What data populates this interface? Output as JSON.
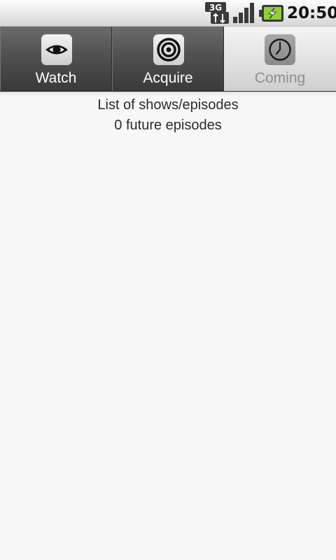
{
  "status_bar": {
    "network_type": "3G",
    "network_icon": "3g-data-icon",
    "signal_icon": "signal-strength-icon",
    "battery_icon": "battery-charging-icon",
    "time": "20:50"
  },
  "tabs": [
    {
      "label": "Watch",
      "icon": "eye-icon",
      "selected": false
    },
    {
      "label": "Acquire",
      "icon": "target-icon",
      "selected": false
    },
    {
      "label": "Coming",
      "icon": "clock-icon",
      "selected": true
    }
  ],
  "content": {
    "heading": "List of shows/episodes",
    "summary": "0 future episodes"
  },
  "colors": {
    "background": "#f7f7f7",
    "tab_inactive": "#505050",
    "tab_active": "#e3e3e3",
    "battery_green": "#8fd13a"
  }
}
